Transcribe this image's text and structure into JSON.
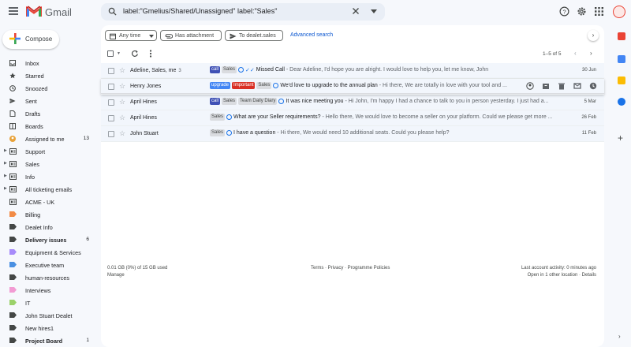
{
  "app": {
    "name": "Gmail"
  },
  "search": {
    "query": "label:\"Gmelius/Shared/Unassigned\" label:\"Sales\""
  },
  "compose": {
    "label": "Compose"
  },
  "sidebar": {
    "items": [
      {
        "label": "Inbox",
        "count": "",
        "bold": false,
        "icon": "inbox-icon",
        "expander": false,
        "color": "#444746"
      },
      {
        "label": "Starred",
        "count": "",
        "bold": false,
        "icon": "star-icon",
        "expander": false,
        "color": "#444746"
      },
      {
        "label": "Snoozed",
        "count": "",
        "bold": false,
        "icon": "clock-icon",
        "expander": false,
        "color": "#444746"
      },
      {
        "label": "Sent",
        "count": "",
        "bold": false,
        "icon": "send-icon",
        "expander": false,
        "color": "#444746"
      },
      {
        "label": "Drafts",
        "count": "",
        "bold": false,
        "icon": "draft-icon",
        "expander": false,
        "color": "#444746"
      },
      {
        "label": "Boards",
        "count": "",
        "bold": false,
        "icon": "board-icon",
        "expander": false,
        "color": "#444746"
      },
      {
        "label": "Assigned to me",
        "count": "13",
        "bold": false,
        "icon": "avatar-icon",
        "expander": false,
        "color": "#e8a23a"
      },
      {
        "label": "Support",
        "count": "",
        "bold": false,
        "icon": "shared-label-icon",
        "expander": true,
        "color": "#444746"
      },
      {
        "label": "Sales",
        "count": "",
        "bold": false,
        "icon": "shared-label-icon",
        "expander": true,
        "color": "#444746"
      },
      {
        "label": "Info",
        "count": "",
        "bold": false,
        "icon": "shared-label-icon",
        "expander": true,
        "color": "#444746"
      },
      {
        "label": "All ticketing emails",
        "count": "",
        "bold": false,
        "icon": "shared-label-icon",
        "expander": true,
        "color": "#444746"
      },
      {
        "label": "ACME - UK",
        "count": "",
        "bold": false,
        "icon": "shared-label-icon",
        "expander": false,
        "color": "#444746"
      },
      {
        "label": "Billing",
        "count": "",
        "bold": false,
        "icon": "label-icon",
        "expander": false,
        "color": "#f28b46"
      },
      {
        "label": "Dealet Info",
        "count": "",
        "bold": false,
        "icon": "label-icon",
        "expander": false,
        "color": "#444746"
      },
      {
        "label": "Delivery issues",
        "count": "6",
        "bold": true,
        "icon": "label-icon",
        "expander": false,
        "color": "#444746"
      },
      {
        "label": "Equipment & Services",
        "count": "",
        "bold": false,
        "icon": "label-icon",
        "expander": false,
        "color": "#a78bfa"
      },
      {
        "label": "Executive team",
        "count": "",
        "bold": false,
        "icon": "label-icon",
        "expander": false,
        "color": "#4a90e2"
      },
      {
        "label": "human-resources",
        "count": "",
        "bold": false,
        "icon": "label-icon",
        "expander": false,
        "color": "#444746"
      },
      {
        "label": "Interviews",
        "count": "",
        "bold": false,
        "icon": "label-icon",
        "expander": false,
        "color": "#f29bd3"
      },
      {
        "label": "IT",
        "count": "",
        "bold": false,
        "icon": "label-icon",
        "expander": false,
        "color": "#9bd16a"
      },
      {
        "label": "John Stuart Dealet",
        "count": "",
        "bold": false,
        "icon": "label-icon",
        "expander": false,
        "color": "#444746"
      },
      {
        "label": "New hires1",
        "count": "",
        "bold": false,
        "icon": "label-icon",
        "expander": false,
        "color": "#444746"
      },
      {
        "label": "Project Board",
        "count": "1",
        "bold": true,
        "icon": "label-icon",
        "expander": false,
        "color": "#444746"
      }
    ]
  },
  "filters": {
    "any_time": "Any time",
    "has_attachment": "Has attachment",
    "to": "To dealet.sales",
    "advanced": "Advanced search"
  },
  "pager": {
    "range": "1–5 of 5"
  },
  "emails": [
    {
      "sender": "Adeline, Sales, me",
      "count": "3",
      "tags": [
        {
          "text": "call",
          "type": "call"
        },
        {
          "text": "Sales",
          "type": "sales"
        }
      ],
      "icon": "gmelius-icon",
      "sent": true,
      "subject": "Missed Call",
      "snippet": " - Dear Adeline, I'd hope you are alright. I would love to help you, let me know, John",
      "date": "30 Jun"
    },
    {
      "sender": "Henry Jones",
      "count": "",
      "tags": [
        {
          "text": "upgrade",
          "type": "upgrade"
        },
        {
          "text": "Important",
          "type": "important"
        },
        {
          "text": "Sales",
          "type": "sales"
        }
      ],
      "icon": "gmelius-icon",
      "sent": false,
      "subject": "We'd love to upgrade to the annual plan",
      "snippet": " - Hi there, We are totally in love with your tool and ...",
      "date": ""
    },
    {
      "sender": "April Hines",
      "count": "",
      "tags": [
        {
          "text": "call",
          "type": "call"
        },
        {
          "text": "Sales",
          "type": "sales"
        },
        {
          "text": "Team Daily Diary",
          "type": "diary"
        }
      ],
      "icon": "gmelius-icon",
      "sent": false,
      "subject": "It was nice meeting you",
      "snippet": " - Hi John, I'm happy I had a chance to talk to you in person yesterday. I just had a...",
      "date": "5 Mar"
    },
    {
      "sender": "April Hines",
      "count": "",
      "tags": [
        {
          "text": "Sales",
          "type": "sales"
        }
      ],
      "icon": "gmelius-icon",
      "sent": false,
      "subject": "What are your Seller requirements?",
      "snippet": " - Hello there, We would love to become a seller on your platform. Could we please get more ...",
      "date": "26 Feb"
    },
    {
      "sender": "John Stuart",
      "count": "",
      "tags": [
        {
          "text": "Sales",
          "type": "sales"
        }
      ],
      "icon": "gmelius-icon",
      "sent": false,
      "subject": "I have a question",
      "snippet": " - Hi there, We would need 10 additional seats. Could you please help?",
      "date": "11 Feb"
    }
  ],
  "footer": {
    "storage": "0.01 GB (0%) of 15 GB used",
    "manage": "Manage",
    "links": "Terms · Privacy · Programme Policies",
    "activity": "Last account activity: 0 minutes ago",
    "sessions": "Open in 1 other location · Details"
  }
}
